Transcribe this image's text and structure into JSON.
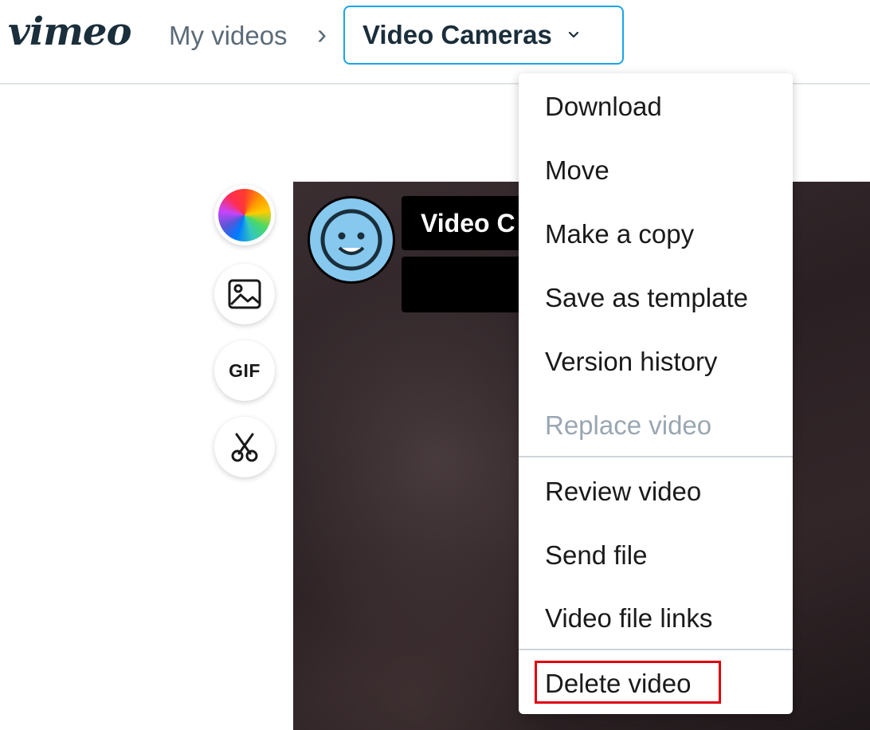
{
  "header": {
    "logo_text": "vimeo",
    "breadcrumb_link": "My videos",
    "breadcrumb_separator": "›",
    "current_title": "Video Cameras",
    "chevron_icon": "chevron-down-icon"
  },
  "tools": [
    {
      "name": "color-wheel-icon"
    },
    {
      "name": "image-icon"
    },
    {
      "name": "gif-icon",
      "label": "GIF"
    },
    {
      "name": "scissors-icon"
    }
  ],
  "video": {
    "title_partial": "Video C",
    "avatar_icon": "smiley-face-icon"
  },
  "menu": {
    "items": [
      {
        "label": "Download",
        "enabled": true
      },
      {
        "label": "Move",
        "enabled": true
      },
      {
        "label": "Make a copy",
        "enabled": true
      },
      {
        "label": "Save as template",
        "enabled": true
      },
      {
        "label": "Version history",
        "enabled": true
      },
      {
        "label": "Replace video",
        "enabled": false
      },
      {
        "label": "Review video",
        "enabled": true
      },
      {
        "label": "Send file",
        "enabled": true
      },
      {
        "label": "Video file links",
        "enabled": true
      },
      {
        "label": "Delete video",
        "enabled": true,
        "highlighted": true
      }
    ]
  },
  "colors": {
    "accent_border": "#1aa5e6",
    "highlight_border": "#e0000f",
    "disabled_text": "#9aa7b2"
  }
}
